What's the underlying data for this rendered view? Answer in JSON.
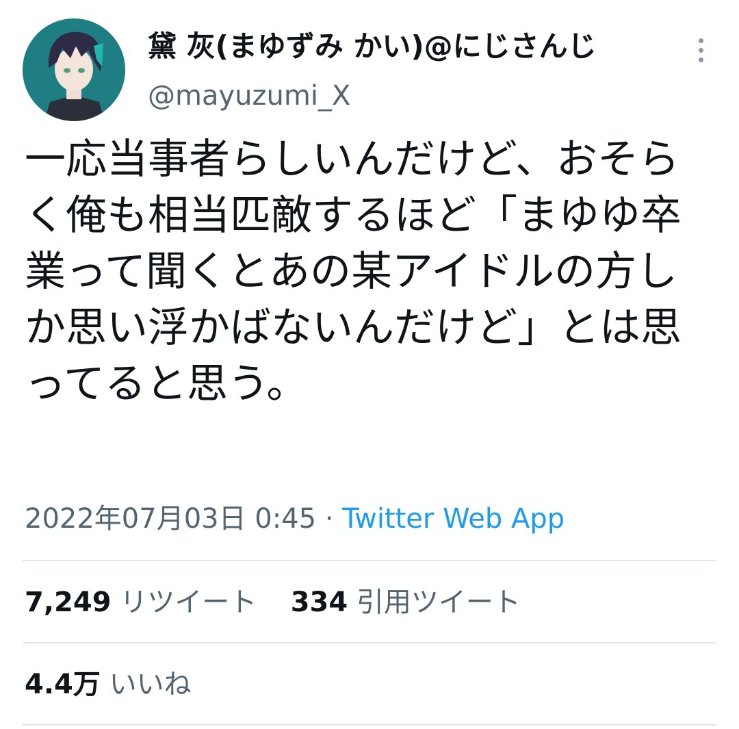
{
  "tweet": {
    "author": {
      "display_name": "黛 灰(まゆずみ かい)@にじさんじ",
      "handle": "@mayuzumi_X",
      "avatar_icon": "avatar-image"
    },
    "more_icon": "more-vertical-icon",
    "text": "一応当事者らしいんだけど、おそらく俺も相当匹敵するほど「まゆゆ卒業って聞くとあの某アイドルの方しか思い浮かばないんだけど」とは思ってると思う。",
    "timestamp": "2022年07月03日 0:45",
    "separator": "·",
    "source": "Twitter Web App",
    "retweets": {
      "count": "7,249",
      "label": "リツイート"
    },
    "quotes": {
      "count": "334",
      "label": "引用ツイート"
    },
    "likes": {
      "count": "4.4万",
      "label": "いいね"
    }
  },
  "colors": {
    "text_primary": "#0f1419",
    "text_secondary": "#536471",
    "link": "#1d9bf0",
    "divider": "#e3e7ea"
  }
}
